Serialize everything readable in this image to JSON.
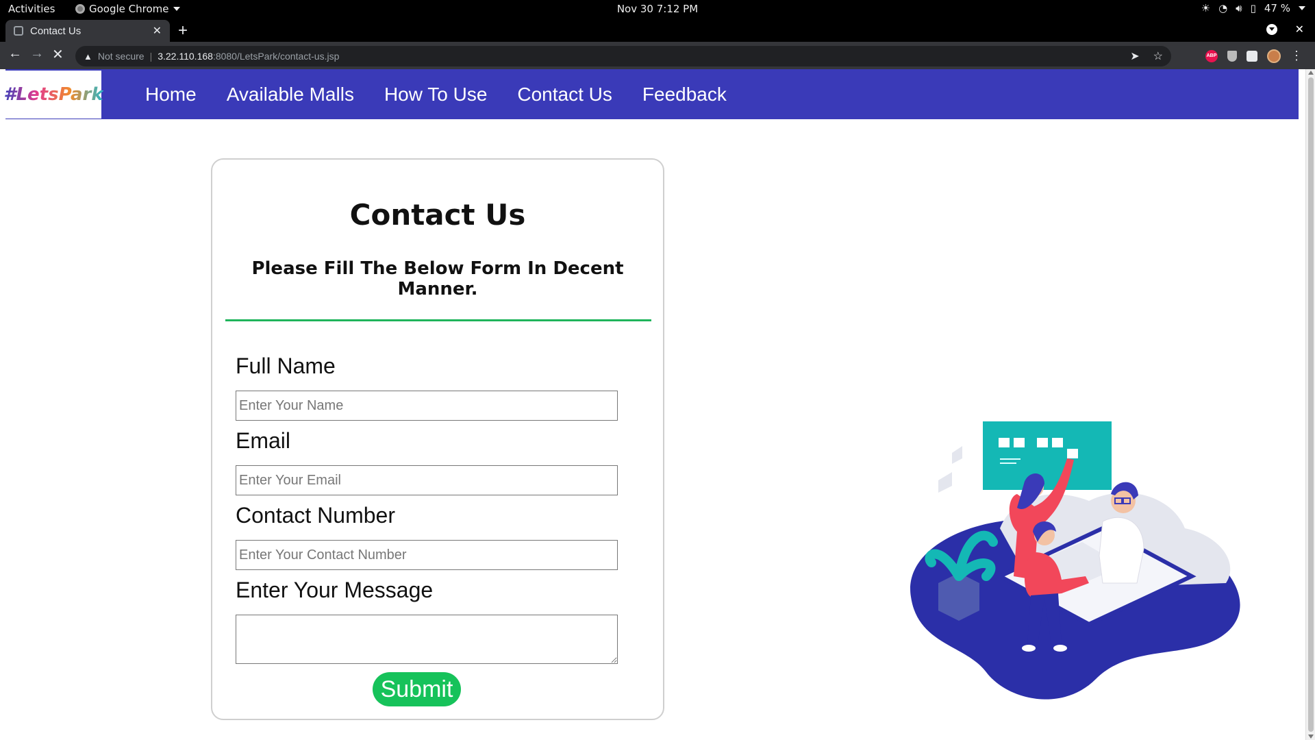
{
  "system_bar": {
    "activities": "Activities",
    "app_name": "Google Chrome",
    "clock": "Nov 30  7:12 PM",
    "battery": "47 %"
  },
  "browser": {
    "tab_title": "Contact Us",
    "security_label": "Not secure",
    "url_host": "3.22.110.168",
    "url_rest": ":8080/LetsPark/contact-us.jsp",
    "abp_badge": "ABP"
  },
  "site": {
    "logo_text": "#LetsPark",
    "nav": [
      {
        "label": "Home"
      },
      {
        "label": "Available Malls"
      },
      {
        "label": "How To Use"
      },
      {
        "label": "Contact Us"
      },
      {
        "label": "Feedback"
      }
    ]
  },
  "form": {
    "title": "Contact Us",
    "subtitle": "Please Fill The Below Form In Decent Manner.",
    "full_name": {
      "label": "Full Name",
      "placeholder": "Enter Your Name",
      "value": ""
    },
    "email": {
      "label": "Email",
      "placeholder": "Enter Your Email",
      "value": ""
    },
    "contact": {
      "label": "Contact Number",
      "placeholder": "Enter Your Contact Number",
      "value": ""
    },
    "message": {
      "label": "Enter Your Message",
      "placeholder": "",
      "value": ""
    },
    "submit_label": "Submit"
  },
  "colors": {
    "navbar": "#3a3ab8",
    "accent_rule": "#1fb45b",
    "submit": "#16c25a",
    "illustration_base": "#2b2fa8",
    "illustration_teal": "#14b8b5",
    "illustration_red": "#f2475a"
  }
}
